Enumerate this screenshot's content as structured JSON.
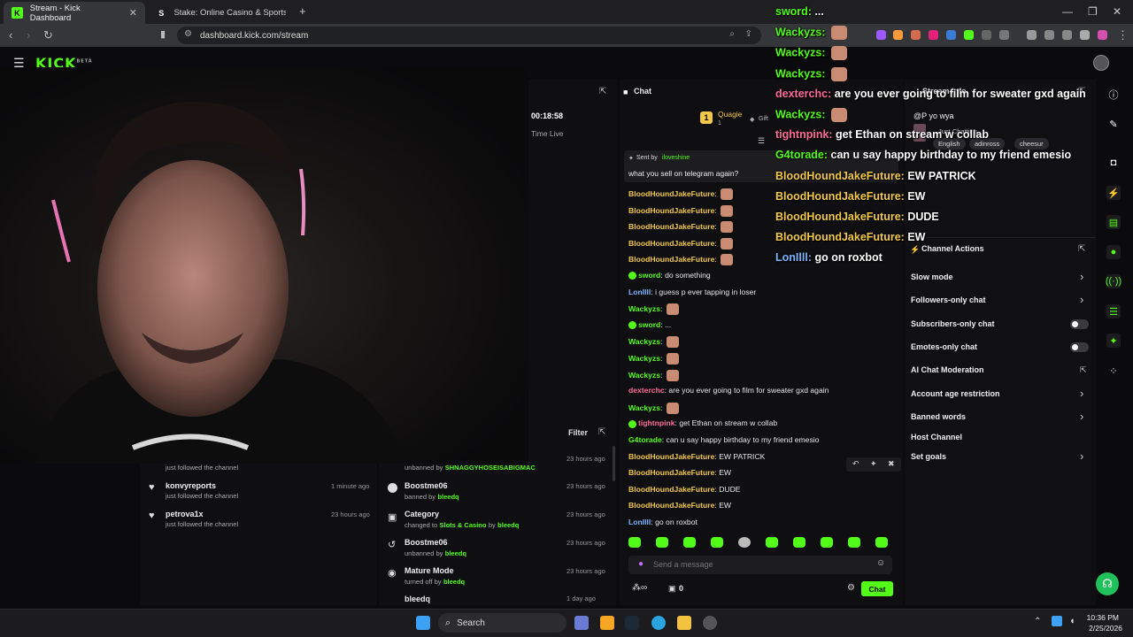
{
  "browser": {
    "tabs": [
      {
        "title": "Stream - Kick Dashboard",
        "fav": "K",
        "favcolor": "#53fc18"
      },
      {
        "title": "Stake: Online Casino & Sports Betting",
        "fav": "S",
        "favcolor": "#ffffff"
      }
    ],
    "url": "dashboard.kick.com/stream"
  },
  "kick": {
    "logo": "KICK",
    "beta": "BETA"
  },
  "stream_panel": {
    "uptime": "00:18:58",
    "uptime_label": "Time Live"
  },
  "chat": {
    "title": "Chat",
    "top_user": "Quagie",
    "top_user_count": "1",
    "gift_label": "Gift",
    "pinned_by_label": "Sent by",
    "pinned_by_user": "iloveshine",
    "pinned_text": "what you sell on telegram again?",
    "messages": [
      {
        "user": "BloodHoundJakeFuture",
        "text": "",
        "emote": true,
        "cls": "u-yellow"
      },
      {
        "user": "BloodHoundJakeFuture",
        "text": "",
        "emote": true,
        "cls": "u-yellow"
      },
      {
        "user": "BloodHoundJakeFuture",
        "text": "",
        "emote": true,
        "cls": "u-yellow"
      },
      {
        "user": "BloodHoundJakeFuture",
        "text": "",
        "emote": true,
        "cls": "u-yellow"
      },
      {
        "user": "BloodHoundJakeFuture",
        "text": "",
        "emote": true,
        "cls": "u-yellow"
      },
      {
        "user": "sword",
        "text": "do something",
        "emote": false,
        "cls": "u-green",
        "badge": true
      },
      {
        "user": "LonIlll",
        "text": "i guess p ever tapping in loser",
        "emote": false,
        "cls": "u-blue"
      },
      {
        "user": "Wackyzs",
        "text": "",
        "emote": true,
        "cls": "u-green"
      },
      {
        "user": "sword",
        "text": "...",
        "emote": false,
        "cls": "u-green",
        "badge": true
      },
      {
        "user": "Wackyzs",
        "text": "",
        "emote": true,
        "cls": "u-green"
      },
      {
        "user": "Wackyzs",
        "text": "",
        "emote": true,
        "cls": "u-green"
      },
      {
        "user": "Wackyzs",
        "text": "",
        "emote": true,
        "cls": "u-green"
      },
      {
        "user": "dexterchc",
        "text": "are you ever going to film for sweater gxd again",
        "emote": false,
        "cls": "u-pink"
      },
      {
        "user": "Wackyzs",
        "text": "",
        "emote": true,
        "cls": "u-green"
      },
      {
        "user": "tightnpink",
        "text": "get Ethan on stream w collab",
        "emote": false,
        "cls": "u-pink",
        "badge": true
      },
      {
        "user": "G4torade",
        "text": "can u say happy birthday to my friend emesio",
        "emote": false,
        "cls": "u-green"
      },
      {
        "user": "BloodHoundJakeFuture",
        "text": "EW PATRICK",
        "emote": false,
        "cls": "u-yellow"
      },
      {
        "user": "BloodHoundJakeFuture",
        "text": "EW",
        "emote": false,
        "cls": "u-yellow"
      },
      {
        "user": "BloodHoundJakeFuture",
        "text": "DUDE",
        "emote": false,
        "cls": "u-yellow"
      },
      {
        "user": "BloodHoundJakeFuture",
        "text": "EW",
        "emote": false,
        "cls": "u-yellow"
      },
      {
        "user": "LonIlll",
        "text": "go on roxbot",
        "emote": false,
        "cls": "u-blue"
      }
    ],
    "input_placeholder": "Send a message",
    "viewer_count": "0",
    "send_label": "Chat"
  },
  "overlay": [
    {
      "user": "sword",
      "text": "...",
      "cls": "u-green",
      "emote": false
    },
    {
      "user": "Wackyzs",
      "text": "",
      "cls": "u-green",
      "emote": true
    },
    {
      "user": "Wackyzs",
      "text": "",
      "cls": "u-green",
      "emote": true
    },
    {
      "user": "Wackyzs",
      "text": "",
      "cls": "u-green",
      "emote": true
    },
    {
      "user": "dexterchc",
      "text": "are you ever going to film for sweater gxd again",
      "cls": "u-pink",
      "emote": false
    },
    {
      "user": "Wackyzs",
      "text": "",
      "cls": "u-green",
      "emote": true
    },
    {
      "user": "tightnpink",
      "text": "get Ethan on stream w collab",
      "cls": "u-pink",
      "emote": false
    },
    {
      "user": "G4torade",
      "text": "can u say happy birthday to my friend emesio",
      "cls": "u-green",
      "emote": false
    },
    {
      "user": "BloodHoundJakeFuture",
      "text": "EW PATRICK",
      "cls": "u-yellow",
      "emote": false
    },
    {
      "user": "BloodHoundJakeFuture",
      "text": "EW",
      "cls": "u-yellow",
      "emote": false
    },
    {
      "user": "BloodHoundJakeFuture",
      "text": "DUDE",
      "cls": "u-yellow",
      "emote": false
    },
    {
      "user": "BloodHoundJakeFuture",
      "text": "EW",
      "cls": "u-yellow",
      "emote": false
    },
    {
      "user": "LonIlll",
      "text": "go on roxbot",
      "cls": "u-blue",
      "emote": false
    }
  ],
  "stream_info": {
    "title": "Stream Info",
    "stream_title": "@P yo wya",
    "category": "Just Chatting",
    "tags": [
      "English",
      "adinross",
      "cheesur"
    ]
  },
  "channel_actions": {
    "title": "Channel Actions",
    "items": [
      {
        "label": "Slow mode",
        "control": "chevron"
      },
      {
        "label": "Followers-only chat",
        "control": "chevron"
      },
      {
        "label": "Subscribers-only chat",
        "control": "toggle"
      },
      {
        "label": "Emotes-only chat",
        "control": "toggle"
      },
      {
        "label": "AI Chat Moderation",
        "control": "external"
      },
      {
        "label": "Account age restriction",
        "control": "chevron"
      },
      {
        "label": "Banned words",
        "control": "chevron"
      },
      {
        "label": "Host Channel",
        "control": "none"
      },
      {
        "label": "Set goals",
        "control": "chevron"
      }
    ]
  },
  "activity_feed": {
    "items": [
      {
        "name": "",
        "sub": "just followed the channel",
        "time": ""
      },
      {
        "name": "konvyreports",
        "sub": "just followed the channel",
        "time": "1 minute ago"
      },
      {
        "name": "petrova1x",
        "sub": "just followed the channel",
        "time": "23 hours ago"
      }
    ]
  },
  "mod_log": {
    "filter_label": "Filter",
    "items": [
      {
        "name": "",
        "action": "unbanned by",
        "target": "SHNAGGYHOSEISABIGMAC",
        "time": "23 hours ago"
      },
      {
        "name": "Boostme06",
        "action": "banned by",
        "target": "bleedq",
        "time": "23 hours ago"
      },
      {
        "name": "Category",
        "action": "changed to",
        "target": "Slots & Casino",
        "target2": "bleedq",
        "time": "23 hours ago"
      },
      {
        "name": "Boostme06",
        "action": "unbanned by",
        "target": "bleedq",
        "time": "23 hours ago"
      },
      {
        "name": "Mature Mode",
        "action": "turned off by",
        "target": "bleedq",
        "time": "23 hours ago"
      },
      {
        "name": "bleedq",
        "action": "",
        "target": "",
        "time": "1 day ago"
      }
    ]
  },
  "taskbar": {
    "search_label": "Search",
    "time": "10:36 PM",
    "date": "2/25/2026"
  }
}
